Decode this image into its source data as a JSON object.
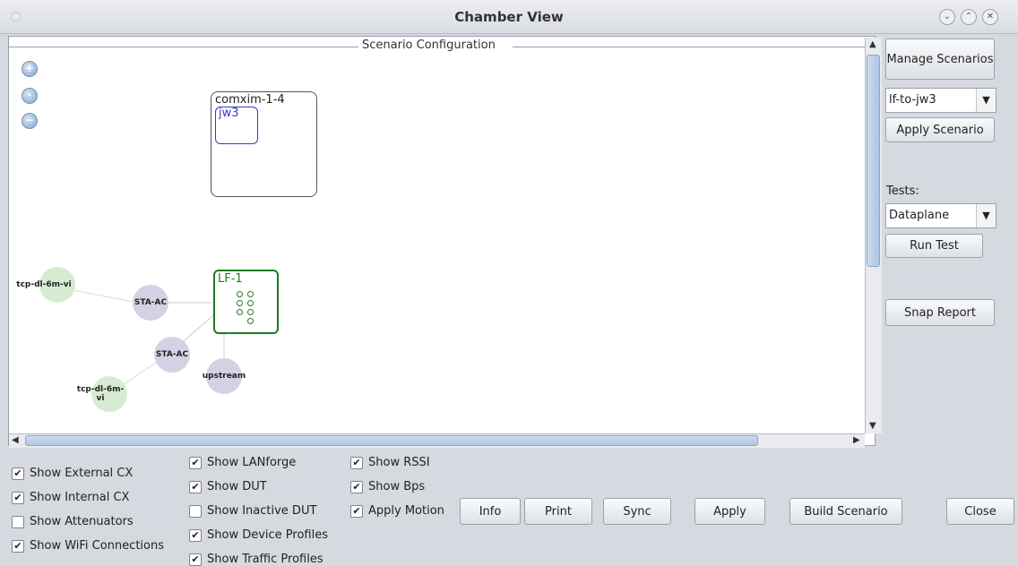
{
  "window": {
    "title": "Chamber View"
  },
  "scenario": {
    "legend": "Scenario Configuration",
    "boxes": [
      {
        "label": "comxim-1-4",
        "inner_label": "jw3"
      }
    ],
    "lf": {
      "label": "LF-1"
    },
    "nodes": {
      "cx_top": "tcp-dl-6m-vi",
      "sta_top": "STA-AC",
      "sta_bottom": "STA-AC",
      "upstream": "upstream",
      "cx_bottom": "tcp-dl-6m-vi"
    }
  },
  "right_panel": {
    "manage_scenarios": "Manage Scenarios",
    "scenario_select": "lf-to-jw3",
    "apply_scenario": "Apply Scenario",
    "tests_label": "Tests:",
    "tests_select": "Dataplane",
    "run_test": "Run Test",
    "snap_report": "Snap Report"
  },
  "checkboxes": {
    "col1": [
      {
        "label": "Show External CX",
        "checked": true
      },
      {
        "label": "Show Internal CX",
        "checked": true
      },
      {
        "label": "Show Attenuators",
        "checked": false
      },
      {
        "label": "Show WiFi Connections",
        "checked": true
      }
    ],
    "col2": [
      {
        "label": "Show LANforge",
        "checked": true
      },
      {
        "label": "Show DUT",
        "checked": true
      },
      {
        "label": "Show Inactive DUT",
        "checked": false
      },
      {
        "label": "Show Device Profiles",
        "checked": true
      },
      {
        "label": "Show Traffic Profiles",
        "checked": true
      }
    ],
    "col3": [
      {
        "label": "Show RSSI",
        "checked": true
      },
      {
        "label": "Show Bps",
        "checked": true
      },
      {
        "label": "Apply Motion",
        "checked": true
      }
    ]
  },
  "bottom_buttons": {
    "info": "Info",
    "print": "Print",
    "sync": "Sync",
    "apply": "Apply",
    "build": "Build Scenario",
    "close": "Close"
  },
  "colors": {
    "lf_green": "#1e7a1e",
    "dut_blue": "#3a3ad0",
    "sta_node": "#d3d2e4",
    "cx_node": "#d7ebd2"
  }
}
